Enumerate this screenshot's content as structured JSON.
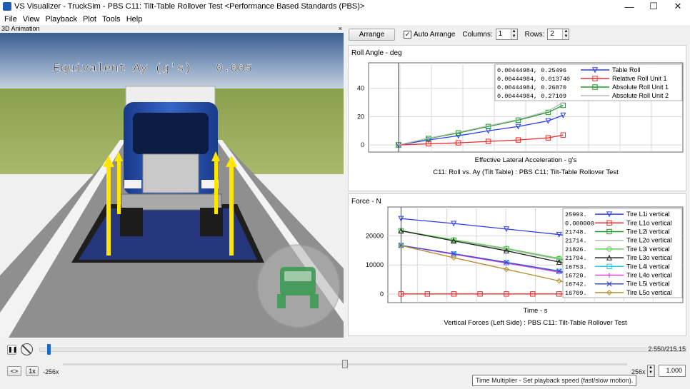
{
  "window": {
    "title": "VS Visualizer - TruckSim - PBS C11: Tilt-Table Rollover Test <Performance Based Standards (PBS)>",
    "minimize": "—",
    "maximize": "☐",
    "close": "✕"
  },
  "menu": [
    "File",
    "View",
    "Playback",
    "Plot",
    "Tools",
    "Help"
  ],
  "anim_panel": {
    "title": "3D Animation",
    "close": "×",
    "overlay_label": "Equivalent Ay (g's)",
    "overlay_value": "0.005",
    "icon": "truck-icon"
  },
  "toolbar": {
    "arrange_label": "Arrange",
    "auto_arrange_label": "Auto Arrange",
    "auto_arrange_checked": true,
    "columns_label": "Columns:",
    "columns_value": "1",
    "rows_label": "Rows:",
    "rows_value": "2"
  },
  "colors": {
    "blue": "#2b3cf0",
    "red": "#ee2a2a",
    "green": "#1d9a2a",
    "lightgreen": "#63d45b",
    "cyan": "#24c8e8",
    "black": "#222222",
    "magenta": "#d24cd2",
    "olive": "#b58e2e",
    "gray": "#bbbbbb",
    "accent": "#1a67c6"
  },
  "chart_data": [
    {
      "type": "line",
      "title": "C11: Roll vs. Ay (Tilt Table) : PBS C11: Tilt-Table Rollover Test",
      "panel_label": "Roll Angle - deg",
      "xlabel": "Effective Lateral Acceleration - g's",
      "ylabel": "",
      "yticks": [
        0,
        20,
        40
      ],
      "ylim": [
        -5,
        58
      ],
      "xlim": [
        -0.1,
        0.95
      ],
      "series": [
        {
          "name": "Table Roll",
          "color": "#2b3cf0",
          "marker": "triangle-down",
          "x": [
            0,
            0.1,
            0.2,
            0.3,
            0.4,
            0.5,
            0.55
          ],
          "y": [
            0,
            3.5,
            6.5,
            10,
            13,
            17,
            21
          ],
          "legend_value": "0.00444984, 0.25496"
        },
        {
          "name": "Relative Roll Unit 1",
          "color": "#ee2a2a",
          "marker": "square",
          "x": [
            0,
            0.1,
            0.2,
            0.3,
            0.4,
            0.5,
            0.55
          ],
          "y": [
            0,
            0.8,
            1.5,
            2.5,
            3.5,
            5,
            7
          ],
          "legend_value": "0.00444984, 0.013740"
        },
        {
          "name": "Absolute Roll Unit 1",
          "color": "#1d9a2a",
          "marker": "square",
          "x": [
            0,
            0.1,
            0.2,
            0.3,
            0.4,
            0.5,
            0.55
          ],
          "y": [
            0,
            4.5,
            8.5,
            13,
            17.5,
            23,
            28
          ],
          "legend_value": "0.00444984, 0.26870"
        },
        {
          "name": "Absolute Roll Unit 2",
          "color": "#bbbbbb",
          "marker": "none",
          "x": [
            0,
            0.1,
            0.2,
            0.3,
            0.4,
            0.5,
            0.55
          ],
          "y": [
            0,
            4.8,
            9,
            13.5,
            18,
            24,
            30
          ],
          "legend_value": "0.00444984, 0.27109"
        }
      ]
    },
    {
      "type": "line",
      "title": "Vertical Forces (Left Side) : PBS C11: Tilt-Table Rollover Test",
      "panel_label": "Force - N",
      "xlabel": "Time - s",
      "ylabel": "",
      "yticks": [
        0,
        10000,
        20000
      ],
      "ylim": [
        -3000,
        30000
      ],
      "xlim": [
        -0.5,
        10.7
      ],
      "series": [
        {
          "name": "Tire L1i vertical",
          "color": "#2b3cf0",
          "marker": "triangle-down",
          "x": [
            0,
            2,
            4,
            6,
            8,
            9,
            9.6,
            9.9
          ],
          "y": [
            25993,
            24300,
            22400,
            20500,
            18000,
            15900,
            13000,
            2000
          ],
          "legend_value": "25993."
        },
        {
          "name": "Tire L1o vertical",
          "color": "#ee2a2a",
          "marker": "square",
          "x": [
            0,
            1,
            2,
            3,
            4,
            5,
            6,
            7,
            8,
            9
          ],
          "y": [
            0,
            0,
            0,
            0,
            0,
            0,
            0,
            0,
            0,
            0
          ],
          "legend_value": "0.000000"
        },
        {
          "name": "Tire L2i vertical",
          "color": "#1d9a2a",
          "marker": "square",
          "x": [
            0,
            2,
            4,
            6,
            8,
            9.3
          ],
          "y": [
            21748,
            18500,
            15500,
            12000,
            8000,
            1000
          ],
          "legend_value": "21748."
        },
        {
          "name": "Tire L2o vertical",
          "color": "#bbbbbb",
          "marker": "none",
          "x": [
            0,
            2,
            4,
            6,
            8,
            9.3
          ],
          "y": [
            21714,
            18400,
            15400,
            11900,
            7900,
            900
          ],
          "legend_value": "21714."
        },
        {
          "name": "Tire L3i vertical",
          "color": "#63d45b",
          "marker": "circle",
          "x": [
            0,
            2,
            4,
            6,
            8,
            9.3
          ],
          "y": [
            21826,
            18700,
            15700,
            12300,
            8300,
            1200
          ],
          "legend_value": "21826."
        },
        {
          "name": "Tire L3o vertical",
          "color": "#222222",
          "marker": "triangle-up",
          "x": [
            0,
            2,
            4,
            6,
            8,
            9.2
          ],
          "y": [
            21794,
            18300,
            14900,
            11000,
            6800,
            500
          ],
          "legend_value": "21794."
        },
        {
          "name": "Tire L4i vertical",
          "color": "#24c8e8",
          "marker": "square",
          "x": [
            0,
            2,
            4,
            6,
            8,
            9.1
          ],
          "y": [
            16753,
            13800,
            10800,
            7800,
            4200,
            300
          ],
          "legend_value": "16753."
        },
        {
          "name": "Tire L4o vertical",
          "color": "#d24cd2",
          "marker": "plus",
          "x": [
            0,
            2,
            4,
            6,
            8,
            9.1
          ],
          "y": [
            16720,
            13700,
            10600,
            7500,
            3900,
            200
          ],
          "legend_value": "16720."
        },
        {
          "name": "Tire L5i vertical",
          "color": "#3a4ad8",
          "marker": "x",
          "x": [
            0,
            2,
            4,
            6,
            8,
            9.1
          ],
          "y": [
            16742,
            13900,
            10900,
            7900,
            4400,
            400
          ],
          "legend_value": "16742."
        },
        {
          "name": "Tire L5o vertical",
          "color": "#b58e2e",
          "marker": "diamond",
          "x": [
            0,
            2,
            4,
            6,
            8
          ],
          "y": [
            16709,
            12500,
            8500,
            4500,
            500
          ],
          "legend_value": "16709."
        }
      ]
    }
  ],
  "playback": {
    "pause_icon": "pause-icon",
    "stop_icon": "no-loop-icon",
    "time_readout": "2.550/215.15",
    "time_progress": 0.012,
    "loop_label": "<>",
    "rate_label": "1x",
    "multiplier_min": "-256x",
    "multiplier_max": "256x",
    "multiplier_value": "1.000",
    "multiplier_progress": 0.5,
    "tooltip": "Time Multiplier - Set playback speed (fast/slow motion)."
  }
}
